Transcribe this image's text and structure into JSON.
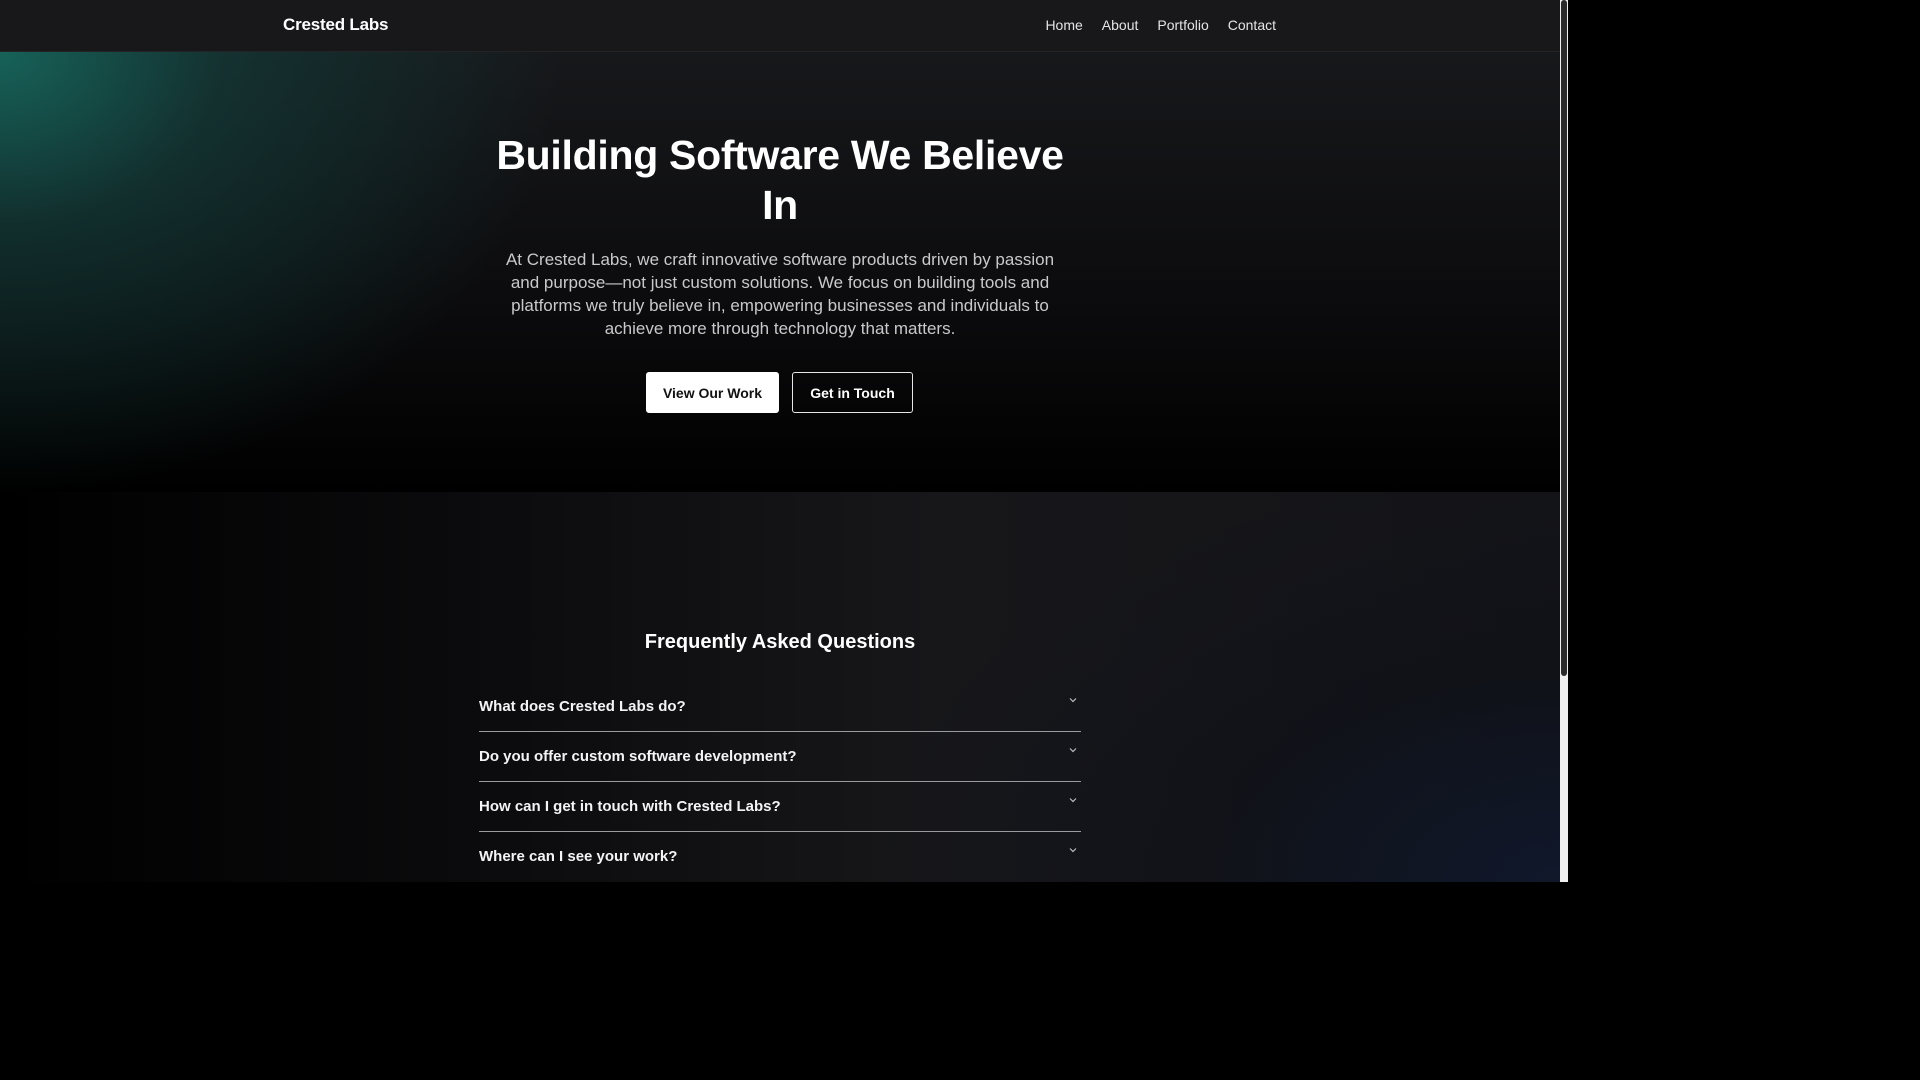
{
  "nav": {
    "brand": "Crested Labs",
    "links": [
      "Home",
      "About",
      "Portfolio",
      "Contact"
    ]
  },
  "hero": {
    "title": "Building Software We Believe In",
    "subtitle": "At Crested Labs, we craft innovative software products driven by passion and purpose—not just custom solutions. We focus on building tools and platforms we truly believe in, empowering businesses and individuals to achieve more through technology that matters.",
    "primary_button": "View Our Work",
    "secondary_button": "Get in Touch"
  },
  "faq": {
    "title": "Frequently Asked Questions",
    "items": [
      "What does Crested Labs do?",
      "Do you offer custom software development?",
      "How can I get in touch with Crested Labs?",
      "Where can I see your work?"
    ]
  },
  "colors": {
    "accent_teal": "#16665c",
    "nav_bg": "#18181a",
    "button_primary_bg": "#ffffff"
  }
}
